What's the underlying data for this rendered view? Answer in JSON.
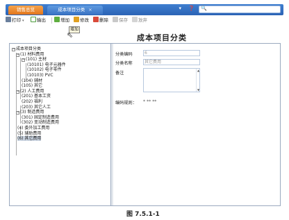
{
  "tabs": [
    {
      "label": "销售总览"
    },
    {
      "label": "成本项目分类",
      "close": "×"
    }
  ],
  "window_controls": "▾ ❓",
  "search": {
    "icon": "search-icon",
    "glyph": "🔍",
    "placeholder": ""
  },
  "toolbar": {
    "print": "打印",
    "export": "输出",
    "add": "增加",
    "edit": "修改",
    "delete": "删除",
    "save": "保存",
    "discard": "放弃",
    "caret": "▾"
  },
  "tooltip": "增加",
  "page_title": "成本项目分类",
  "tree": {
    "root": "成本项目分类",
    "nodes": [
      {
        "label": "(1) 材料费用"
      },
      {
        "label": "(101) 主材"
      },
      {
        "label": "(10101) 电子元器件"
      },
      {
        "label": "(10102) 电子零件"
      },
      {
        "label": "(10103) PVC"
      },
      {
        "label": "(104) 辅材"
      },
      {
        "label": "(105) 其它"
      },
      {
        "label": "(2) 人工费用"
      },
      {
        "label": "(201) 基本工资"
      },
      {
        "label": "(202) 福利"
      },
      {
        "label": "(203) 其它人工"
      },
      {
        "label": "(3) 制造费用"
      },
      {
        "label": "(301) 固定制造费用"
      },
      {
        "label": "(302) 变动制造费用"
      },
      {
        "label": "(4) 委外加工费用"
      },
      {
        "label": "(5) 辅助费用"
      },
      {
        "label": "(6) 其它费用"
      }
    ]
  },
  "form": {
    "code_label": "分类编码",
    "code_value": "6",
    "name_label": "分类名称",
    "name_value": "其它费用",
    "remark_label": "备注",
    "remark_value": "",
    "rule_label": "编码规则：",
    "rule_value": "* ** **"
  },
  "caption": "图 7.5.1-1"
}
